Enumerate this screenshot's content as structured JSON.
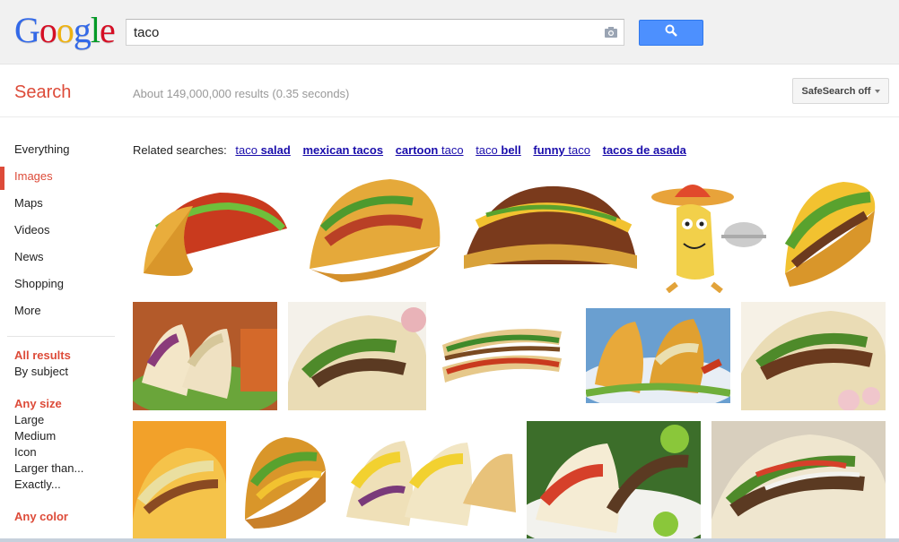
{
  "header": {
    "logo": [
      "G",
      "o",
      "o",
      "g",
      "l",
      "e"
    ],
    "logo_colors": [
      "#3369e8",
      "#d50f25",
      "#eeb211",
      "#3369e8",
      "#009925",
      "#d50f25"
    ],
    "query": "taco",
    "search_icon": "magnifier-icon",
    "camera_icon": "camera-icon"
  },
  "subheader": {
    "title": "Search",
    "results": "About 149,000,000 results (0.35 seconds)",
    "safesearch": "SafeSearch off"
  },
  "nav": {
    "items": [
      {
        "label": "Everything",
        "active": false
      },
      {
        "label": "Images",
        "active": true
      },
      {
        "label": "Maps",
        "active": false
      },
      {
        "label": "Videos",
        "active": false
      },
      {
        "label": "News",
        "active": false
      },
      {
        "label": "Shopping",
        "active": false
      },
      {
        "label": "More",
        "active": false
      }
    ],
    "results_group": [
      "All results",
      "By subject"
    ],
    "size_group": [
      "Any size",
      "Large",
      "Medium",
      "Icon",
      "Larger than...",
      "Exactly..."
    ],
    "color_group": [
      "Any color"
    ]
  },
  "related": {
    "label": "Related searches:",
    "links": [
      {
        "pre": "taco ",
        "bold": "salad"
      },
      {
        "pre": "",
        "bold": "mexican tacos"
      },
      {
        "pre": "",
        "bold": "cartoon",
        "post": " taco"
      },
      {
        "pre": "taco ",
        "bold": "bell"
      },
      {
        "pre": "",
        "bold": "funny",
        "post": " taco"
      },
      {
        "pre": "",
        "bold": "tacos de asada"
      }
    ]
  },
  "colors": {
    "accent_red": "#dd4b39",
    "link_blue": "#1a0dab",
    "button_blue": "#4d90fe"
  }
}
